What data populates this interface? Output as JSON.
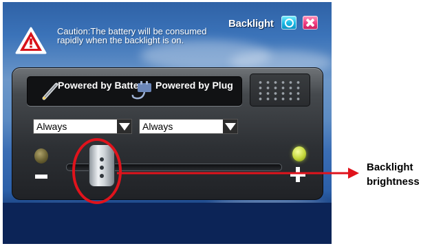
{
  "window": {
    "title": "Backlight",
    "caution_text": "Caution:The battery will be consumed rapidly when the backlight is on."
  },
  "power": {
    "battery_label": "Powered by Battery",
    "plug_label": "Powered by Plug"
  },
  "dropdowns": [
    {
      "selected": "Always"
    },
    {
      "selected": "Always"
    }
  ],
  "brightness": {
    "level_fraction": 0.12
  },
  "annotation": {
    "label": "Backlight brightness"
  },
  "colors": {
    "window_bg": "#3b73b9",
    "highlight": "#e0131c",
    "close_button": "#ef3b7f",
    "toggle_button": "#16b7e4"
  },
  "icons": [
    "warning-icon",
    "battery-pen-icon",
    "plug-icon",
    "power-toggle-icon",
    "close-icon",
    "keypad-icon"
  ]
}
